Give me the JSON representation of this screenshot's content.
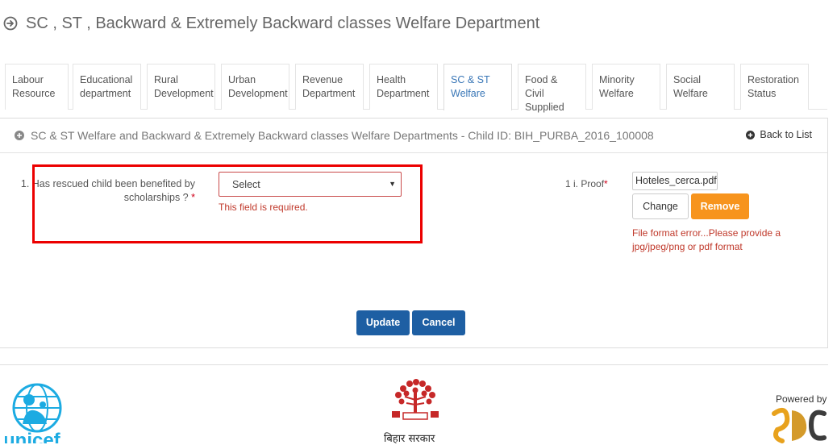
{
  "header": {
    "title": "SC , ST , Backward & Extremely Backward classes Welfare Department"
  },
  "tabs": [
    {
      "line1": "Labour",
      "line2": "Resource"
    },
    {
      "line1": "Educational",
      "line2": "department"
    },
    {
      "line1": "Rural",
      "line2": "Development"
    },
    {
      "line1": "Urban",
      "line2": "Development"
    },
    {
      "line1": "Revenue",
      "line2": "Department"
    },
    {
      "line1": "Health",
      "line2": "Department"
    },
    {
      "line1": "SC & ST",
      "line2": "Welfare"
    },
    {
      "line1": "Food & Civil",
      "line2": "Supplied"
    },
    {
      "line1": "Minority",
      "line2": "Welfare"
    },
    {
      "line1": "Social",
      "line2": "Welfare"
    },
    {
      "line1": "Restoration",
      "line2": "Status"
    }
  ],
  "active_tab": "SC & ST Welfare",
  "panel": {
    "title": "SC & ST Welfare and Backward & Extremely Backward classes Welfare Departments - Child ID: BIH_PURBA_2016_100008",
    "back_label": "Back to List"
  },
  "form": {
    "question": "1. Has rescued child been benefited by scholarships ?",
    "required_mark": "*",
    "select_value": "Select",
    "error": "This field is required.",
    "proof_label": "1 i. Proof",
    "proof_required_mark": "*",
    "file_name": "Hoteles_cerca.pdf",
    "change_label": "Change",
    "remove_label": "Remove",
    "file_error": "File format error...Please provide a jpg/jpeg/png or pdf format",
    "update_label": "Update",
    "cancel_label": "Cancel"
  },
  "footer": {
    "unicef_text": "unicef",
    "bihar_text": "बिहार सरकार",
    "powered_by": "Powered by"
  },
  "colors": {
    "accent_blue": "#1e5fa3",
    "remove_orange": "#f7941d",
    "error_red": "#c0392b",
    "highlight_red": "#ec0000",
    "active_tab_text": "#3a77b7",
    "unicef_blue": "#1cabe2"
  }
}
